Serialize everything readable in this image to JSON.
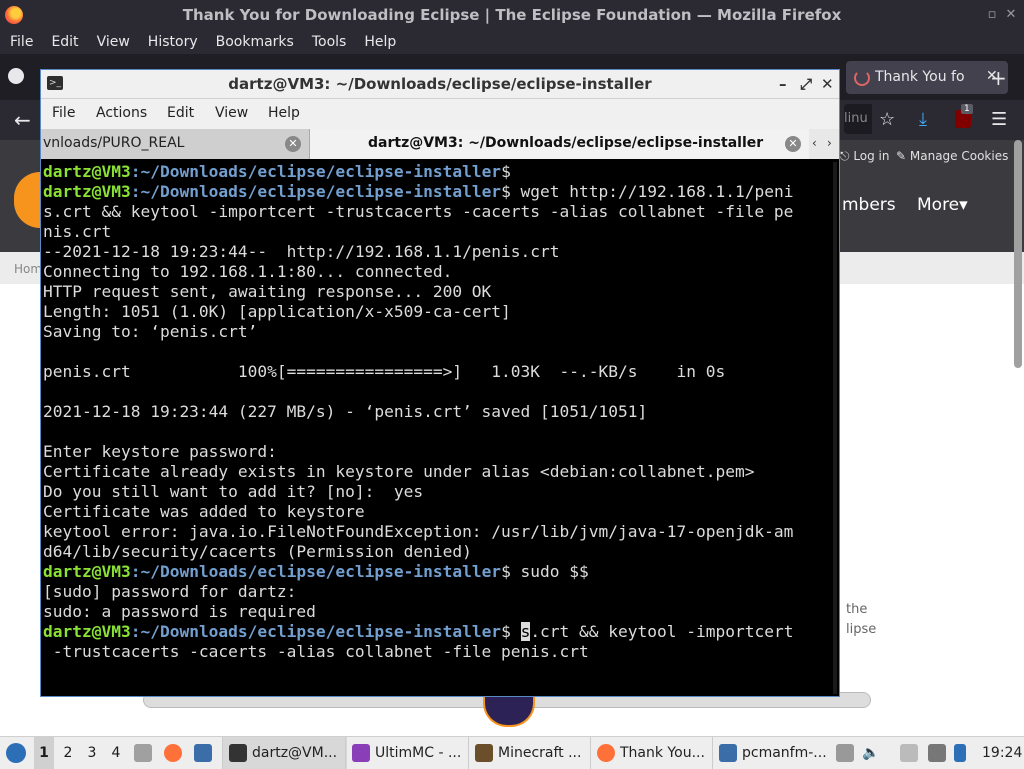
{
  "firefox": {
    "window_title": "Thank You for Downloading Eclipse | The Eclipse Foundation — Mozilla Firefox",
    "menu": [
      "File",
      "Edit",
      "View",
      "History",
      "Bookmarks",
      "Tools",
      "Help"
    ],
    "active_tab": "Thank You fo",
    "url_fragment": "linu",
    "badge_count": "1"
  },
  "website": {
    "login": "Log in",
    "manage_cookies": "Manage Cookies",
    "nav_partial": "mbers",
    "nav_more": "More",
    "breadcrumb": "Hom",
    "para_line1": "the",
    "para_line2": "lipse"
  },
  "terminal": {
    "title": "dartz@VM3: ~/Downloads/eclipse/eclipse-installer",
    "menu": [
      "File",
      "Actions",
      "Edit",
      "View",
      "Help"
    ],
    "tabs": [
      {
        "label": "vnloads/PURO_REAL"
      },
      {
        "label": "dartz@VM3: ~/Downloads/eclipse/eclipse-installer"
      }
    ],
    "prompt_user": "dartz@VM3",
    "prompt_path": ":~/Downloads/eclipse/eclipse-installer",
    "lines": {
      "l2_cmd": " wget http://192.168.1.1/peni",
      "l3": "s.crt && keytool -importcert -trustcacerts -cacerts -alias collabnet -file pe",
      "l4": "nis.crt",
      "l5": "--2021-12-18 19:23:44--  http://192.168.1.1/penis.crt",
      "l6": "Connecting to 192.168.1.1:80... connected.",
      "l7": "HTTP request sent, awaiting response... 200 OK",
      "l8": "Length: 1051 (1.0K) [application/x-x509-ca-cert]",
      "l9": "Saving to: ‘penis.crt’",
      "l11": "penis.crt           100%[================>]   1.03K  --.-KB/s    in 0s",
      "l13": "2021-12-18 19:23:44 (227 MB/s) - ‘penis.crt’ saved [1051/1051]",
      "l15": "Enter keystore password:",
      "l16": "Certificate already exists in keystore under alias <debian:collabnet.pem>",
      "l17": "Do you still want to add it? [no]:  yes",
      "l18": "Certificate was added to keystore",
      "l19": "keytool error: java.io.FileNotFoundException: /usr/lib/jvm/java-17-openjdk-am",
      "l20": "d64/lib/security/cacerts (Permission denied)",
      "l21_cmd": " sudo $$",
      "l22": "[sudo] password for dartz:",
      "l23": "sudo: a password is required",
      "l24_cursor": "s",
      "l24_rest": ".crt && keytool -importcert",
      "l25": " -trustcacerts -cacerts -alias collabnet -file penis.crt"
    }
  },
  "taskbar": {
    "workspaces": [
      "1",
      "2",
      "3",
      "4"
    ],
    "tasks": [
      "dartz@VM...",
      "UltimMC - ...",
      "Minecraft ...",
      "Thank You...",
      "pcmanfm-..."
    ],
    "clock": "19:24"
  }
}
